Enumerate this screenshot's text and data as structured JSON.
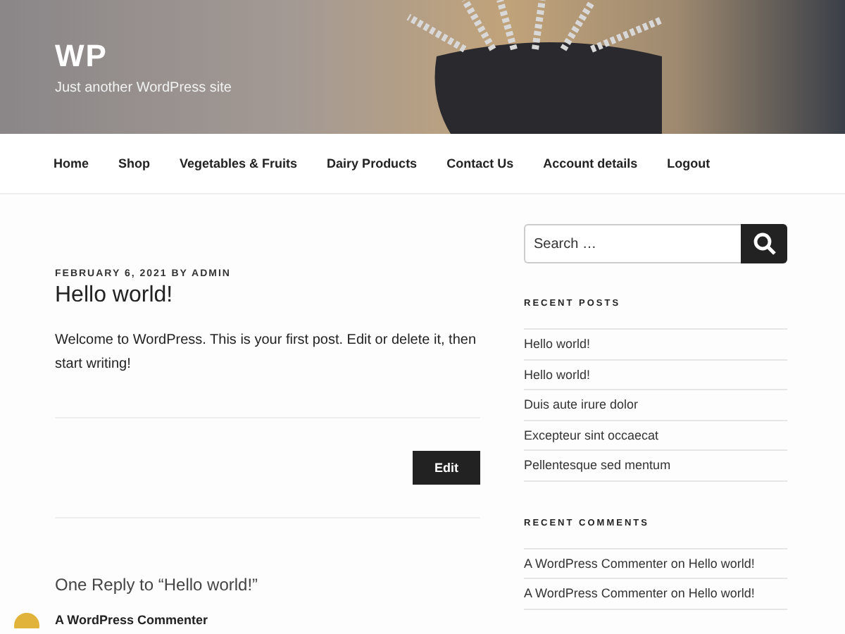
{
  "site": {
    "title": "WP",
    "tagline": "Just another WordPress site"
  },
  "nav": [
    {
      "label": "Home"
    },
    {
      "label": "Shop"
    },
    {
      "label": "Vegetables & Fruits"
    },
    {
      "label": "Dairy Products"
    },
    {
      "label": "Contact Us"
    },
    {
      "label": "Account details"
    },
    {
      "label": "Logout"
    }
  ],
  "post": {
    "meta": "FEBRUARY 6, 2021 BY ADMIN",
    "title": "Hello world!",
    "body": "Welcome to WordPress. This is your first post. Edit or delete it, then start writing!",
    "edit_button": "Edit"
  },
  "comments": {
    "heading": "One Reply to “Hello world!”",
    "author": "A WordPress Commenter"
  },
  "sidebar": {
    "search": {
      "placeholder": "Search …"
    },
    "recent_posts": {
      "heading": "RECENT POSTS",
      "items": [
        "Hello world!",
        "Hello world!",
        "Duis aute irure dolor",
        "Excepteur sint occaecat",
        "Pellentesque sed mentum"
      ]
    },
    "recent_comments": {
      "heading": "RECENT COMMENTS",
      "items": [
        {
          "author": "A WordPress Commenter",
          "joiner": "on",
          "post": "Hello world!"
        },
        {
          "author": "A WordPress Commenter",
          "joiner": "on",
          "post": "Hello world!"
        }
      ]
    }
  }
}
